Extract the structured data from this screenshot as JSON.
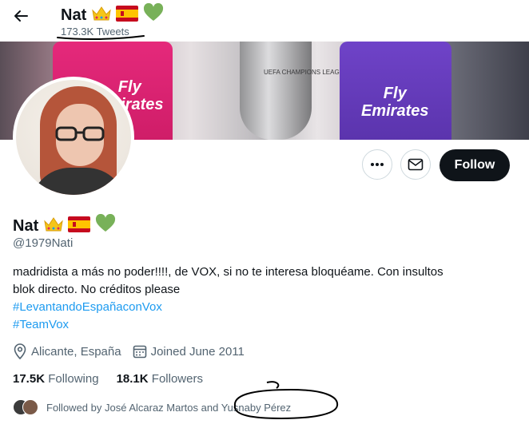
{
  "header": {
    "name": "Nat",
    "tweet_count": "173.3K Tweets"
  },
  "banner": {
    "jersey_left_text": "Fly\nEmirates",
    "jersey_right_text": "Fly\nEmirates",
    "trophy_text": "UEFA CHAMPIONS LEAGUE"
  },
  "actions": {
    "follow_label": "Follow"
  },
  "profile": {
    "name": "Nat",
    "handle": "@1979Nati",
    "bio_line1": "madridista a más no poder!!!!, de VOX, si no te interesa bloquéame. Con insultos",
    "bio_line2": "blok directo. No créditos please",
    "hashtag1": "#LevantandoEspañaconVox",
    "hashtag2": "#TeamVox",
    "location": "Alicante, España",
    "joined": "Joined June 2011",
    "following_count": "17.5K",
    "following_label": "Following",
    "followers_count": "18.1K",
    "followers_label": "Followers",
    "followed_by": "Followed by José Alcaraz Martos and Yusnaby Pérez"
  },
  "colors": {
    "accent": "#1d9bf0",
    "follow_bg": "#0f1419",
    "muted": "#536471"
  },
  "icons": [
    "back-arrow-icon",
    "crown-icon",
    "spain-flag-icon",
    "green-heart-icon",
    "more-icon",
    "mail-icon",
    "location-icon",
    "calendar-icon"
  ]
}
